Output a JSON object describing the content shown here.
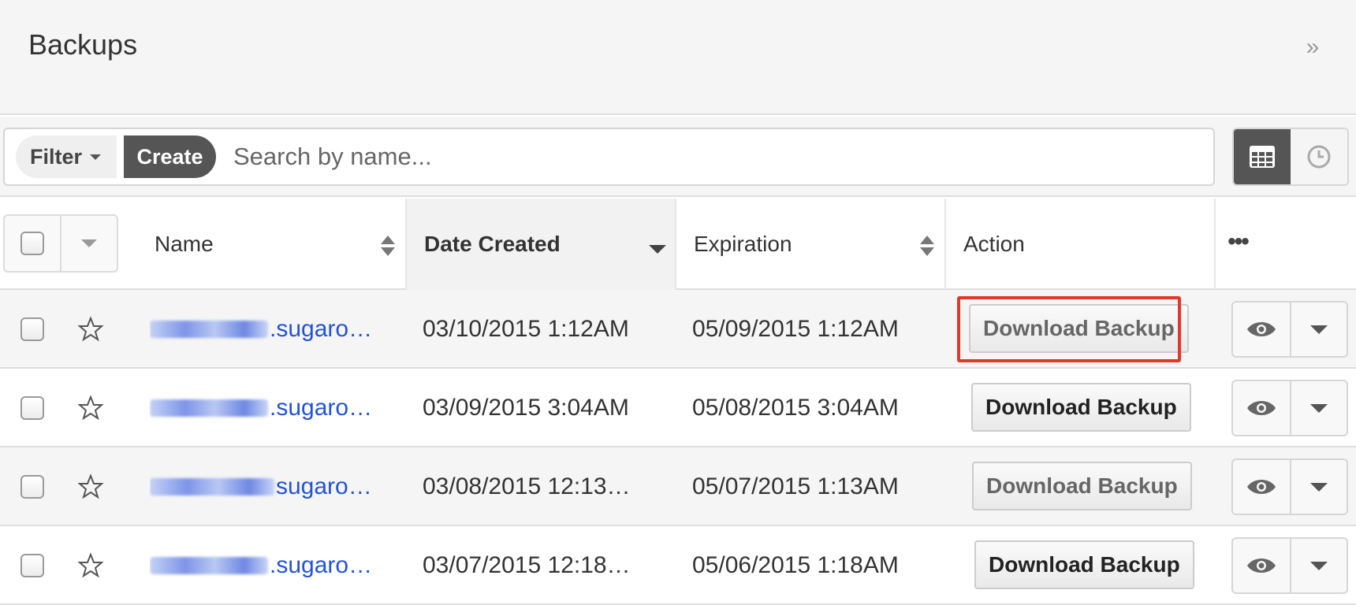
{
  "header": {
    "title": "Backups",
    "collapse_icon": "double-chevron-right-icon"
  },
  "filter_bar": {
    "filter_label": "Filter",
    "create_label": "Create",
    "search_placeholder": "Search by name...",
    "views": [
      "list-view-icon",
      "activity-stream-clock-icon"
    ]
  },
  "table": {
    "columns": {
      "name": "Name",
      "date_created": "Date Created",
      "expiration": "Expiration",
      "action": "Action",
      "more": "•••"
    },
    "rows": [
      {
        "name_visible": ".sugaro…",
        "date_created": "03/10/2015 1:12AM",
        "expiration": "05/09/2015 1:12AM",
        "action": "Download Backup"
      },
      {
        "name_visible": ".sugaro…",
        "date_created": "03/09/2015 3:04AM",
        "expiration": "05/08/2015 3:04AM",
        "action": "Download Backup"
      },
      {
        "name_visible": "sugaro…",
        "date_created": "03/08/2015 12:13…",
        "expiration": "05/07/2015 1:13AM",
        "action": "Download Backup"
      },
      {
        "name_visible": ".sugaro…",
        "date_created": "03/07/2015 12:18…",
        "expiration": "05/06/2015 1:18AM",
        "action": "Download Backup"
      }
    ]
  },
  "colors": {
    "accent_link": "#2252d8",
    "highlight_border": "#e2372a",
    "active_toggle": "#555555"
  }
}
